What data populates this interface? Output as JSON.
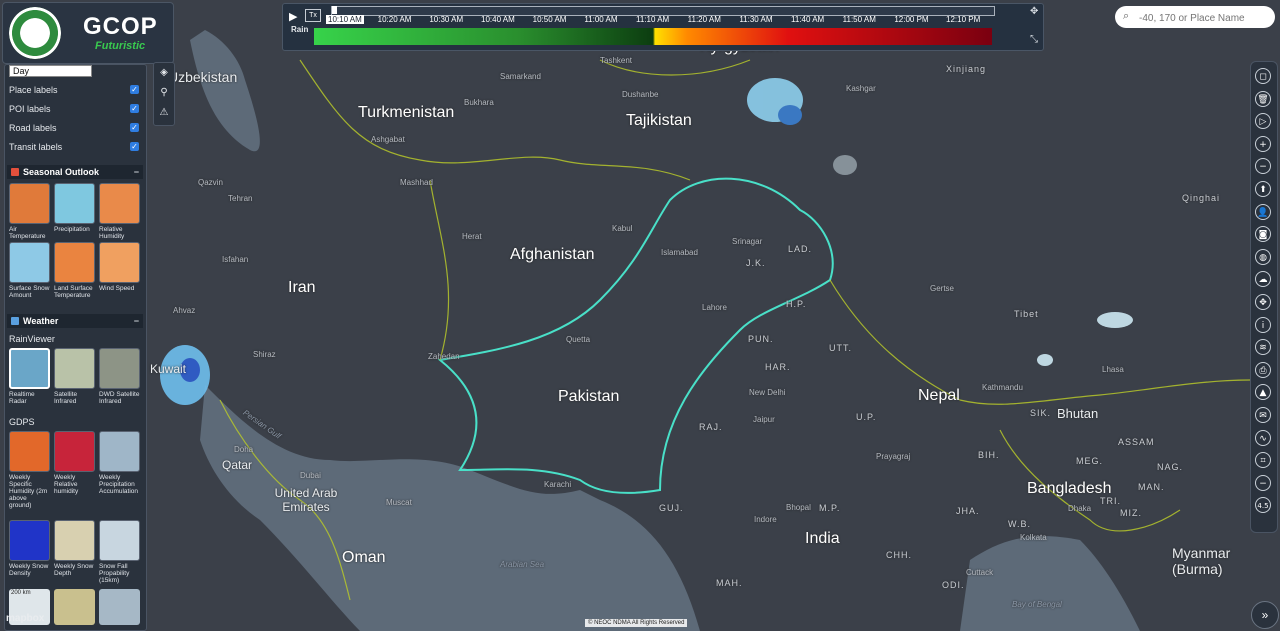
{
  "app": {
    "logo_title": "GCOP",
    "logo_subtitle": "Futuristic"
  },
  "left_panel": {
    "style_select_value": "Day",
    "label_toggles": [
      {
        "label": "Place labels",
        "checked": true
      },
      {
        "label": "POI labels",
        "checked": true
      },
      {
        "label": "Road labels",
        "checked": true
      },
      {
        "label": "Transit labels",
        "checked": true
      }
    ],
    "seasonal": {
      "title": "Seasonal Outlook",
      "collapse": "−",
      "tiles": [
        {
          "label": "Air Temperature",
          "color": "#e07a3a"
        },
        {
          "label": "Precipitation",
          "color": "#7fc8e0"
        },
        {
          "label": "Relative Humidity",
          "color": "#e98a4a"
        },
        {
          "label": "Surface Snow Amount",
          "color": "#8ec9e6"
        },
        {
          "label": "Land Surface Temperature",
          "color": "#ea8440"
        },
        {
          "label": "Wind Speed",
          "color": "#f0a060"
        }
      ]
    },
    "weather": {
      "title": "Weather",
      "collapse": "−",
      "rainviewer_title": "RainViewer",
      "rainviewer_tiles": [
        {
          "label": "Realtime Radar",
          "color": "#6aa6c8",
          "active": true
        },
        {
          "label": "Satellite Infrared",
          "color": "#b9c2a8",
          "active": false
        },
        {
          "label": "DWD Satellite Infrared",
          "color": "#8d9486",
          "active": false
        }
      ],
      "gdps_title": "GDPS",
      "gdps_tiles": [
        {
          "label": "Weekly Specific Humidity (2m above ground)",
          "color": "#e2682a"
        },
        {
          "label": "Weekly Relative humidity",
          "color": "#c7243a"
        },
        {
          "label": "Weekly Precipitation Accumulation",
          "color": "#9fb6c8"
        },
        {
          "label": "Weekly Snow Density",
          "color": "#2034c8"
        },
        {
          "label": "Weekly Snow Depth",
          "color": "#d8d0b0"
        },
        {
          "label": "Snow Fall Propability (15km)",
          "color": "#c8d6e0"
        }
      ],
      "scale_label": "200 km"
    }
  },
  "tools": [
    {
      "name": "layers-icon",
      "glyph": "◈"
    },
    {
      "name": "marker-icon",
      "glyph": "⚲"
    },
    {
      "name": "warning-icon",
      "glyph": "⚠"
    }
  ],
  "timeline": {
    "play_glyph": "▶",
    "layer_chip": "Tx",
    "layer_name": "Rain",
    "ticks": [
      "10:10 AM",
      "10:20 AM",
      "10:30 AM",
      "10:40 AM",
      "10:50 AM",
      "11:00 AM",
      "11:10 AM",
      "11:20 AM",
      "11:30 AM",
      "11:40 AM",
      "11:50 AM",
      "12:00 PM",
      "12:10 PM"
    ],
    "current_tick_index": 0,
    "progress": 0.0
  },
  "search": {
    "placeholder": "-40, 170 or Place Name",
    "value": ""
  },
  "right_toolbar": [
    {
      "name": "draw-polygon-icon",
      "glyph": "◻"
    },
    {
      "name": "trash-icon",
      "glyph": "🗑"
    },
    {
      "name": "play-animation-icon",
      "glyph": "▷"
    },
    {
      "name": "zoom-in-icon",
      "glyph": "+"
    },
    {
      "name": "zoom-out-icon",
      "glyph": "−"
    },
    {
      "name": "compass-icon",
      "glyph": "⬆"
    },
    {
      "name": "user-icon",
      "glyph": "👤"
    },
    {
      "name": "camera-icon",
      "glyph": "◙"
    },
    {
      "name": "globe-icon",
      "glyph": "◍"
    },
    {
      "name": "weather-icon",
      "glyph": "☁"
    },
    {
      "name": "move-icon",
      "glyph": "✥"
    },
    {
      "name": "info-icon",
      "glyph": "i"
    },
    {
      "name": "layers-stack-icon",
      "glyph": "≋"
    },
    {
      "name": "print-icon",
      "glyph": "⎙"
    },
    {
      "name": "terrain-icon",
      "glyph": "▲"
    },
    {
      "name": "comment-icon",
      "glyph": "✉"
    },
    {
      "name": "chart-icon",
      "glyph": "∿"
    },
    {
      "name": "crop-icon",
      "glyph": "⌗"
    },
    {
      "name": "minus-icon",
      "glyph": "−"
    },
    {
      "name": "version-label",
      "glyph": "4.5"
    }
  ],
  "map_labels": {
    "countries": [
      "Turkmenistan",
      "Tajikistan",
      "Kyrgyzstan",
      "Afghanistan",
      "Iran",
      "Pakistan",
      "India",
      "Nepal",
      "Bhutan",
      "Bangladesh",
      "Myanmar (Burma)",
      "Oman",
      "United Arab Emirates",
      "Qatar",
      "Kuwait",
      "Tibet",
      "Xinjiang",
      "Qinghai",
      "Uzbekistan"
    ],
    "regions": [
      "J.K.",
      "LAD.",
      "H.P.",
      "PUN.",
      "HAR.",
      "UTT.",
      "U.P.",
      "RAJ.",
      "M.P.",
      "GUJ.",
      "BIH.",
      "ASSAM",
      "MEG.",
      "MAN.",
      "MIZ.",
      "TRI.",
      "ODI.",
      "CHH.",
      "MAH.",
      "JHA.",
      "W.B.",
      "SIK.",
      "NAG."
    ],
    "cities": [
      "Ashgabat",
      "Mashhad",
      "Tehran",
      "Qazvin",
      "Isfahan",
      "Shiraz",
      "Ahvaz",
      "Herat",
      "Kabul",
      "Islamabad",
      "Lahore",
      "Quetta",
      "Zahedan",
      "Karachi",
      "New Delhi",
      "Jaipur",
      "Bhopal",
      "Indore",
      "Prayagraj",
      "Kathmandu",
      "Dhaka",
      "Kolkata",
      "Srinagar",
      "Dushanbe",
      "Gertse",
      "Cuttack",
      "Doha",
      "Dubai",
      "Muscat",
      "Samarkand",
      "Bukhara",
      "Tashkent",
      "Kashgar",
      "Lhasa"
    ],
    "seas": [
      "Persian Gulf",
      "Arabian Sea",
      "Bay of Bengal"
    ]
  },
  "footer": {
    "mapbox": "mapbox",
    "attribution": "© NEOC NDMA All Rights Reserved",
    "expand_glyph": "»"
  }
}
